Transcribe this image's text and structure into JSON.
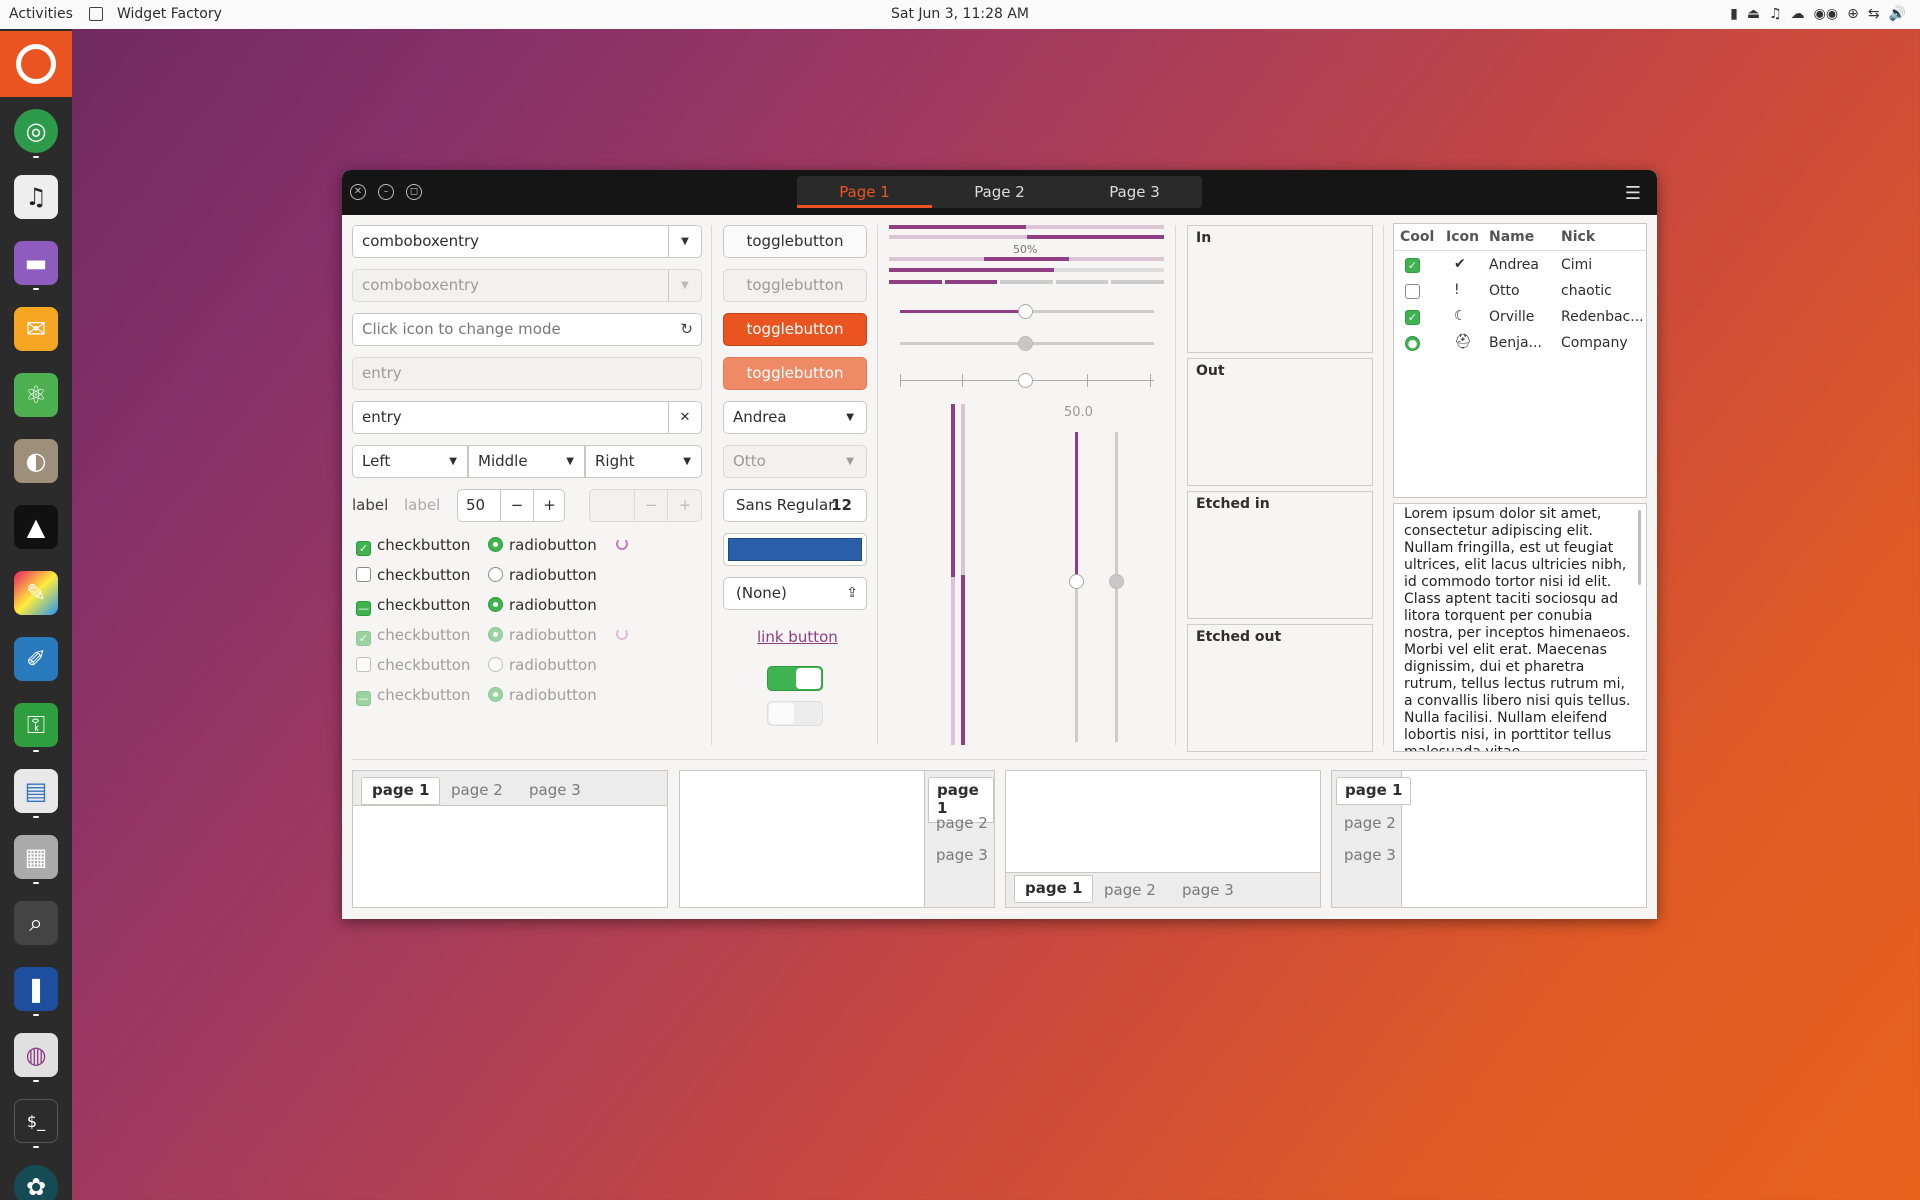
{
  "topbar": {
    "activities": "Activities",
    "app_name": "Widget Factory",
    "clock": "Sat Jun  3, 11:28 AM",
    "tray": [
      "▮",
      "⏏",
      "♫",
      "☁",
      "◉◉",
      "⊕",
      "⇆",
      "🔊"
    ]
  },
  "window": {
    "tabs": [
      "Page 1",
      "Page 2",
      "Page 3"
    ],
    "col1": {
      "combo1": "comboboxentry",
      "combo2": "comboboxentry",
      "entry_icon_placeholder": "Click icon to change mode",
      "entry_disabled": "entry",
      "entry_clear": "entry",
      "dropdowns": [
        "Left",
        "Middle",
        "Right"
      ],
      "label1": "label",
      "label2": "label",
      "spin_value": "50",
      "checks": [
        "checkbutton",
        "checkbutton",
        "checkbutton",
        "checkbutton",
        "checkbutton",
        "checkbutton"
      ],
      "radios": [
        "radiobutton",
        "radiobutton",
        "radiobutton",
        "radiobutton",
        "radiobutton",
        "radiobutton"
      ]
    },
    "col2": {
      "toggles": [
        "togglebutton",
        "togglebutton",
        "togglebutton",
        "togglebutton"
      ],
      "combo_name": "Andrea",
      "combo_name2": "Otto",
      "font_name": "Sans Regular",
      "font_size": "12",
      "color": "#2a5ea8",
      "file": "(None)",
      "link": "link button",
      "switch_on": true
    },
    "col3": {
      "progress_label": "50%",
      "scale_value": "50.0",
      "progress": 0.5
    },
    "frames": [
      "In",
      "Out",
      "Etched in",
      "Etched out"
    ],
    "tree": {
      "headers": [
        "Cool",
        "Icon",
        "Name",
        "Nick"
      ],
      "rows": [
        {
          "cool": true,
          "icon": "check-circle-icon",
          "glyph": "✔",
          "name": "Andrea",
          "nick": "Cimi"
        },
        {
          "cool": false,
          "icon": "warning-icon",
          "glyph": "!",
          "name": "Otto",
          "nick": "chaotic"
        },
        {
          "cool": true,
          "icon": "moon-icon",
          "glyph": "☾",
          "name": "Orville",
          "nick": "Redenbac..."
        },
        {
          "cool": "radio",
          "icon": "hat-icon",
          "glyph": "⛑",
          "name": "Benja...",
          "nick": "Company"
        }
      ]
    },
    "textview": "Lorem ipsum dolor sit amet, consectetur adipiscing elit. Nullam fringilla, est ut feugiat ultrices, elit lacus ultricies nibh, id commodo tortor nisi id elit. Class aptent taciti sociosqu ad litora torquent per conubia nostra, per inceptos himenaeos. Morbi vel elit erat. Maecenas dignissim, dui et pharetra rutrum, tellus lectus rutrum mi, a convallis libero nisi quis tellus. Nulla facilisi. Nullam eleifend lobortis nisi, in porttitor tellus malesuada vitae.",
    "notebook_tabs": [
      "page 1",
      "page 2",
      "page 3"
    ]
  },
  "colors": {
    "accent": "#e95420",
    "check": "#3eb34f",
    "progress": "#8f3e84"
  }
}
